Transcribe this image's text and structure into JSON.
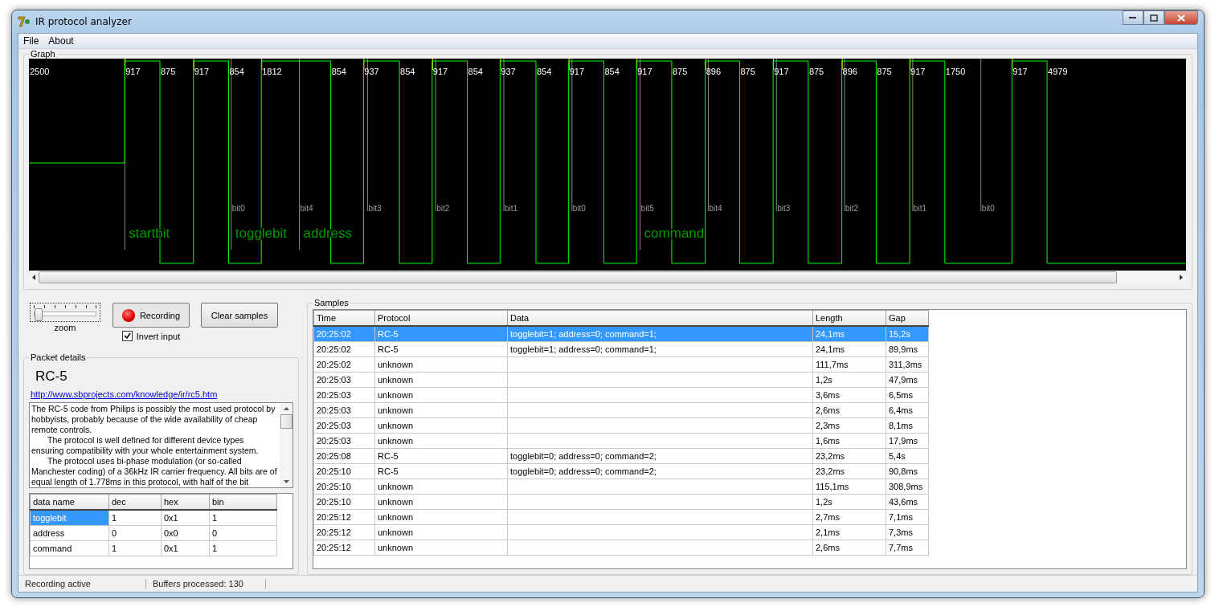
{
  "window": {
    "title": "IR protocol analyzer"
  },
  "menu": [
    "File",
    "About"
  ],
  "graph": {
    "title": "Graph",
    "segments": [
      {
        "label": "2500",
        "kind": "idle"
      },
      {
        "label": "917",
        "kind": "high"
      },
      {
        "label": "875",
        "kind": "low"
      },
      {
        "label": "917",
        "kind": "high"
      },
      {
        "label": "854",
        "kind": "low"
      },
      {
        "label": "1812",
        "kind": "high"
      },
      {
        "label": "854",
        "kind": "low"
      },
      {
        "label": "937",
        "kind": "high"
      },
      {
        "label": "854",
        "kind": "low"
      },
      {
        "label": "917",
        "kind": "high"
      },
      {
        "label": "854",
        "kind": "low"
      },
      {
        "label": "937",
        "kind": "high"
      },
      {
        "label": "854",
        "kind": "low"
      },
      {
        "label": "917",
        "kind": "high"
      },
      {
        "label": "854",
        "kind": "low"
      },
      {
        "label": "917",
        "kind": "high"
      },
      {
        "label": "875",
        "kind": "low"
      },
      {
        "label": "896",
        "kind": "high"
      },
      {
        "label": "875",
        "kind": "low"
      },
      {
        "label": "917",
        "kind": "high"
      },
      {
        "label": "875",
        "kind": "low"
      },
      {
        "label": "896",
        "kind": "high"
      },
      {
        "label": "875",
        "kind": "low"
      },
      {
        "label": "917",
        "kind": "high"
      },
      {
        "label": "1750",
        "kind": "low"
      },
      {
        "label": "917",
        "kind": "high"
      },
      {
        "label": "4979",
        "kind": "low"
      }
    ],
    "fields": [
      {
        "name": "startbit"
      },
      {
        "name": "togglebit",
        "bits": [
          "bit0"
        ]
      },
      {
        "name": "address",
        "bits": [
          "bit4",
          "bit3",
          "bit2",
          "bit1",
          "bit0"
        ]
      },
      {
        "name": "command",
        "bits": [
          "bit5",
          "bit4",
          "bit3",
          "bit2",
          "bit1",
          "bit0"
        ]
      }
    ]
  },
  "zoom": {
    "label": "zoom",
    "level": 0
  },
  "record_button": {
    "label": "Recording",
    "on": true
  },
  "clear_button": {
    "label": "Clear samples"
  },
  "invert_input": {
    "label": "Invert input",
    "checked": true
  },
  "packet_details": {
    "title": "Packet details",
    "protocol": "RC-5",
    "link": "http://www.sbprojects.com/knowledge/ir/rc5.htm",
    "description": [
      "The RC-5 code from Philips is possibly the most used protocol by hobbyists, probably because of the wide availability of cheap remote controls.",
      "The protocol is well defined for different device types ensuring compatibility with your whole entertainment system.",
      "The protocol uses bi-phase modulation (or so-called Manchester coding) of a 36kHz IR carrier frequency. All bits are of equal length of 1.778ms in this protocol, with half of the bit"
    ],
    "columns": [
      "data name",
      "dec",
      "hex",
      "bin"
    ],
    "rows": [
      {
        "cells": [
          "togglebit",
          "1",
          "0x1",
          "1"
        ],
        "selected": true
      },
      {
        "cells": [
          "address",
          "0",
          "0x0",
          "0"
        ],
        "selected": false
      },
      {
        "cells": [
          "command",
          "1",
          "0x1",
          "1"
        ],
        "selected": false
      }
    ]
  },
  "samples": {
    "title": "Samples",
    "columns": [
      "Time",
      "Protocol",
      "Data",
      "Length",
      "Gap"
    ],
    "rows": [
      {
        "cells": [
          "20:25:02",
          "RC-5",
          "togglebit=1; address=0; command=1;",
          "24,1ms",
          "15,2s"
        ],
        "selected": true
      },
      {
        "cells": [
          "20:25:02",
          "RC-5",
          "togglebit=1; address=0; command=1;",
          "24,1ms",
          "89,9ms"
        ],
        "selected": false
      },
      {
        "cells": [
          "20:25:02",
          "unknown",
          "",
          "111,7ms",
          "311,3ms"
        ],
        "selected": false
      },
      {
        "cells": [
          "20:25:03",
          "unknown",
          "",
          "1,2s",
          "47,9ms"
        ],
        "selected": false
      },
      {
        "cells": [
          "20:25:03",
          "unknown",
          "",
          "3,6ms",
          "6,5ms"
        ],
        "selected": false
      },
      {
        "cells": [
          "20:25:03",
          "unknown",
          "",
          "2,6ms",
          "6,4ms"
        ],
        "selected": false
      },
      {
        "cells": [
          "20:25:03",
          "unknown",
          "",
          "2,3ms",
          "8,1ms"
        ],
        "selected": false
      },
      {
        "cells": [
          "20:25:03",
          "unknown",
          "",
          "1,6ms",
          "17,9ms"
        ],
        "selected": false
      },
      {
        "cells": [
          "20:25:08",
          "RC-5",
          "togglebit=0; address=0; command=2;",
          "23,2ms",
          "5,4s"
        ],
        "selected": false
      },
      {
        "cells": [
          "20:25:10",
          "RC-5",
          "togglebit=0; address=0; command=2;",
          "23,2ms",
          "90,8ms"
        ],
        "selected": false
      },
      {
        "cells": [
          "20:25:10",
          "unknown",
          "",
          "115,1ms",
          "308,9ms"
        ],
        "selected": false
      },
      {
        "cells": [
          "20:25:10",
          "unknown",
          "",
          "1,2s",
          "43,6ms"
        ],
        "selected": false
      },
      {
        "cells": [
          "20:25:12",
          "unknown",
          "",
          "2,7ms",
          "7,1ms"
        ],
        "selected": false
      },
      {
        "cells": [
          "20:25:12",
          "unknown",
          "",
          "2,1ms",
          "7,3ms"
        ],
        "selected": false
      },
      {
        "cells": [
          "20:25:12",
          "unknown",
          "",
          "2,6ms",
          "7,7ms"
        ],
        "selected": false
      }
    ]
  },
  "status_bar": [
    "Recording active",
    "Buffers processed: 130"
  ]
}
